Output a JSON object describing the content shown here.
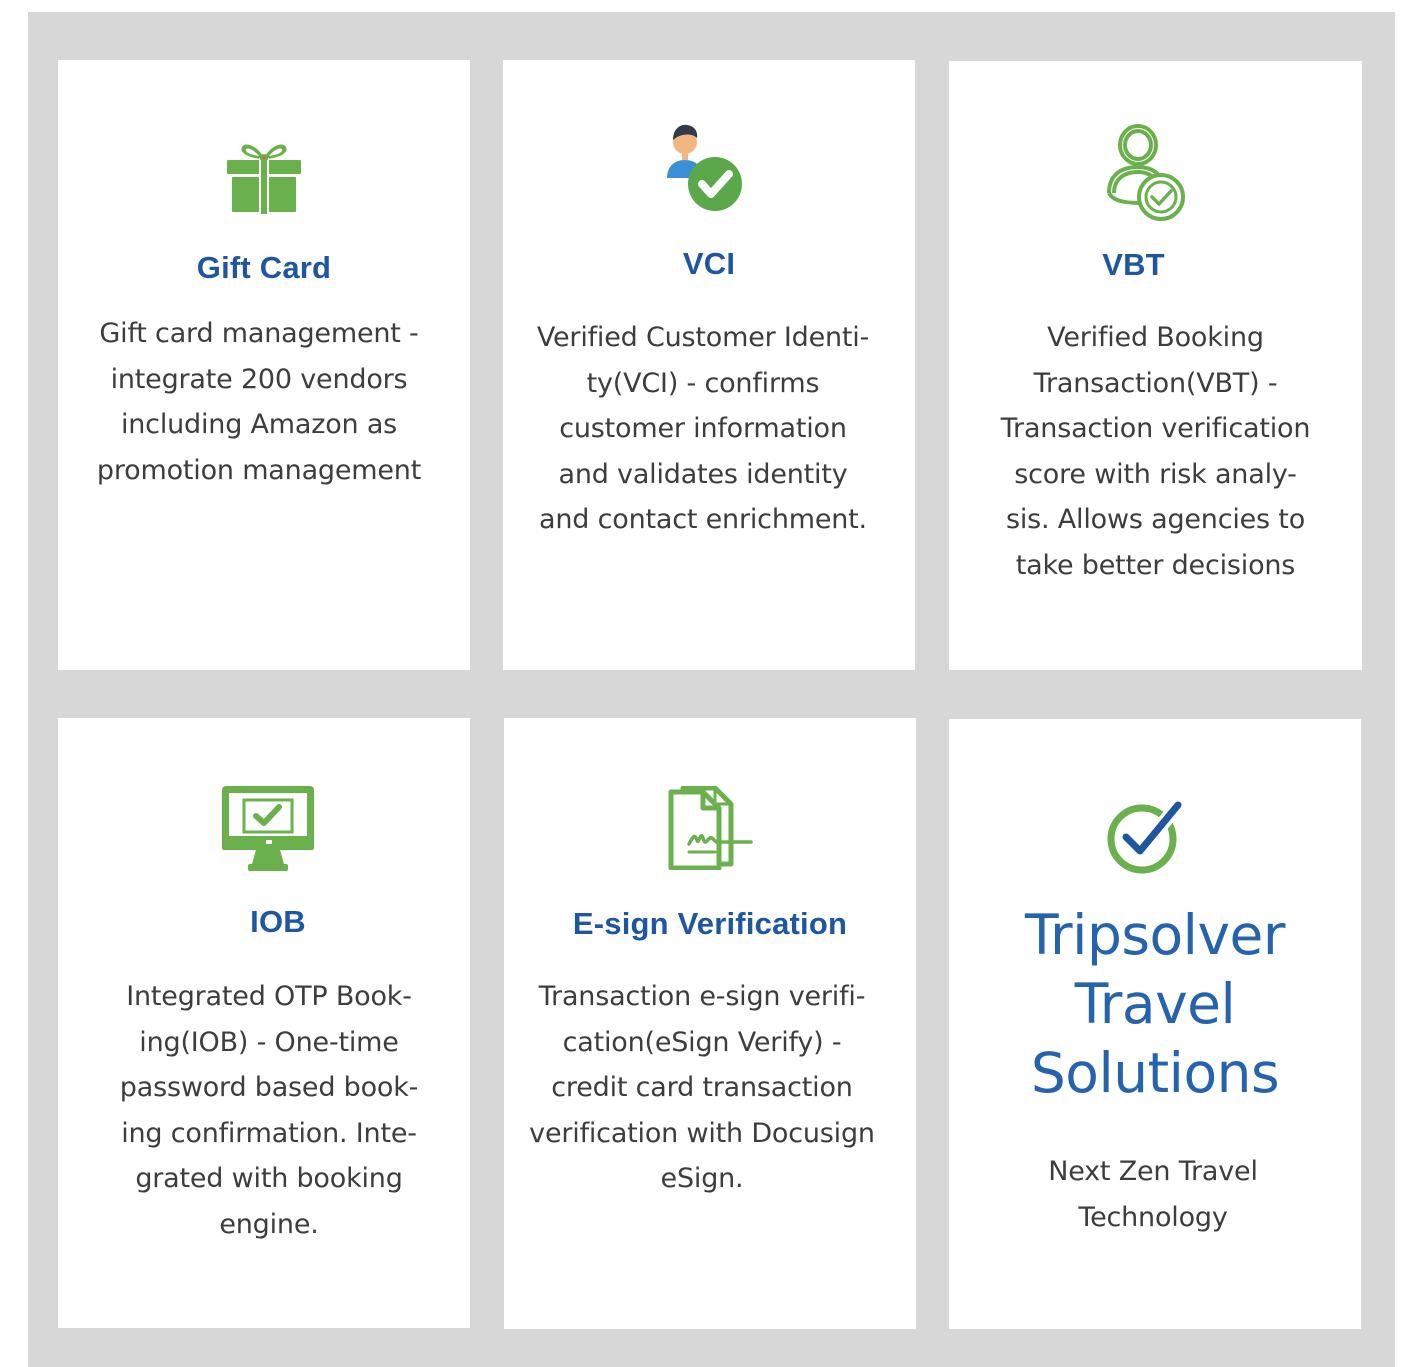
{
  "cards": [
    {
      "icon": "gift-icon",
      "title": "Gift Card",
      "description": "Gift card management - integrate 200 vendors including Amazon as promotion management"
    },
    {
      "icon": "verified-user-icon",
      "title": "VCI",
      "description": "Verified Customer Identi-ty(VCI) - confirms customer information and validates identity and contact enrichment."
    },
    {
      "icon": "user-check-icon",
      "title": "VBT",
      "description": "Verified Booking Transaction(VBT) - Transaction verification score with risk analy-sis. Allows agencies to take better decisions"
    },
    {
      "icon": "monitor-check-icon",
      "title": "IOB",
      "description": "Integrated OTP Book-ing(IOB) - One-time password based book-ing confirmation. Inte-grated with booking engine."
    },
    {
      "icon": "document-signature-icon",
      "title": "E-sign Verification",
      "description": "Transaction e-sign verifi-cation(eSign Verify) - credit card transaction verification with Docusign eSign."
    }
  ],
  "brand": {
    "icon": "check-circle-icon",
    "title": "Tripsolver Travel Solutions",
    "tagline": "Next Zen Travel Technology"
  },
  "colors": {
    "panel_background": "#d7d7d7",
    "card_background": "#ffffff",
    "title_blue": "#1f56a0",
    "brand_blue": "#2563ae",
    "icon_green": "#6ab04c",
    "tagline_green": "#63ad45",
    "body_text": "#3d3d3d"
  }
}
